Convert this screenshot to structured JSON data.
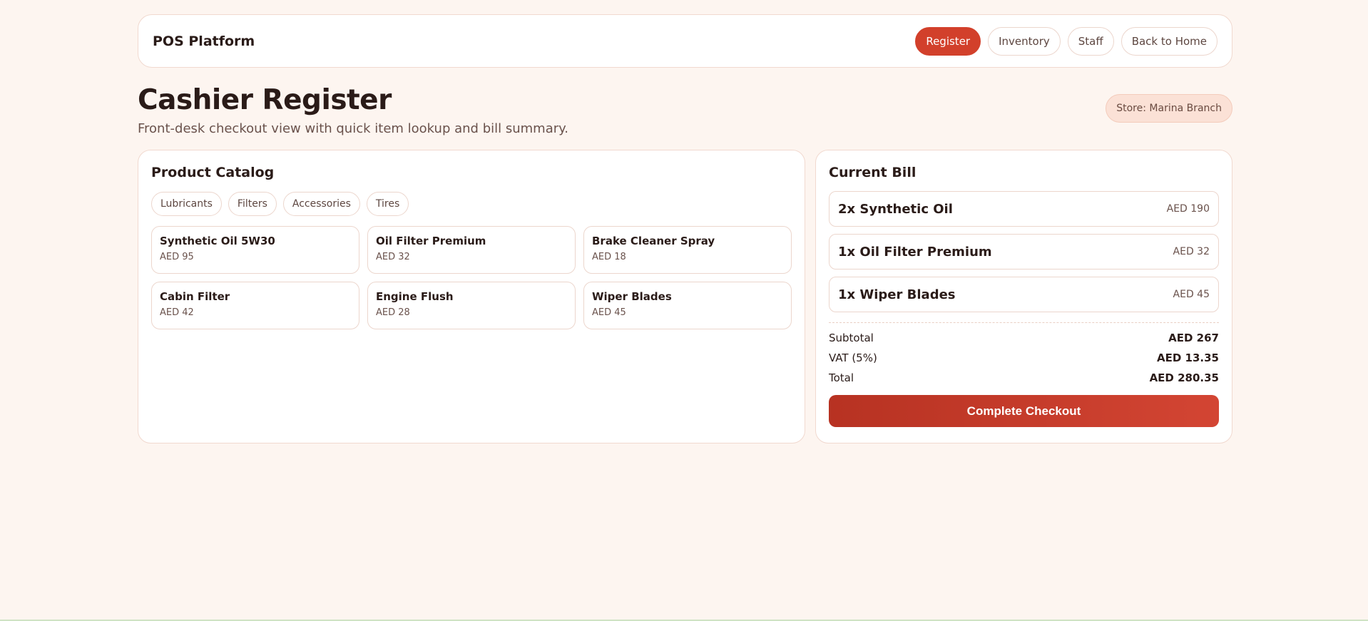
{
  "nav": {
    "brand": "POS Platform",
    "links": [
      "Register",
      "Inventory",
      "Staff",
      "Back to Home"
    ],
    "active": "Register"
  },
  "header": {
    "title": "Cashier Register",
    "subtitle": "Front-desk checkout view with quick item lookup and bill summary.",
    "store_badge": "Store: Marina Branch"
  },
  "catalog": {
    "title": "Product Catalog",
    "categories": [
      "Lubricants",
      "Filters",
      "Accessories",
      "Tires"
    ],
    "products": [
      {
        "name": "Synthetic Oil 5W30",
        "price": "AED 95"
      },
      {
        "name": "Oil Filter Premium",
        "price": "AED 32"
      },
      {
        "name": "Brake Cleaner Spray",
        "price": "AED 18"
      },
      {
        "name": "Cabin Filter",
        "price": "AED 42"
      },
      {
        "name": "Engine Flush",
        "price": "AED 28"
      },
      {
        "name": "Wiper Blades",
        "price": "AED 45"
      }
    ]
  },
  "bill": {
    "title": "Current Bill",
    "items": [
      {
        "name": "2x Synthetic Oil",
        "amount": "AED 190"
      },
      {
        "name": "1x Oil Filter Premium",
        "amount": "AED 32"
      },
      {
        "name": "1x Wiper Blades",
        "amount": "AED 45"
      }
    ],
    "subtotal_label": "Subtotal",
    "subtotal": "AED 267",
    "vat_label": "VAT (5%)",
    "vat": "AED 13.35",
    "total_label": "Total",
    "total": "AED 280.35",
    "checkout_label": "Complete Checkout"
  },
  "colors": {
    "accent": "#d2402b",
    "background": "#fdf5f0"
  }
}
